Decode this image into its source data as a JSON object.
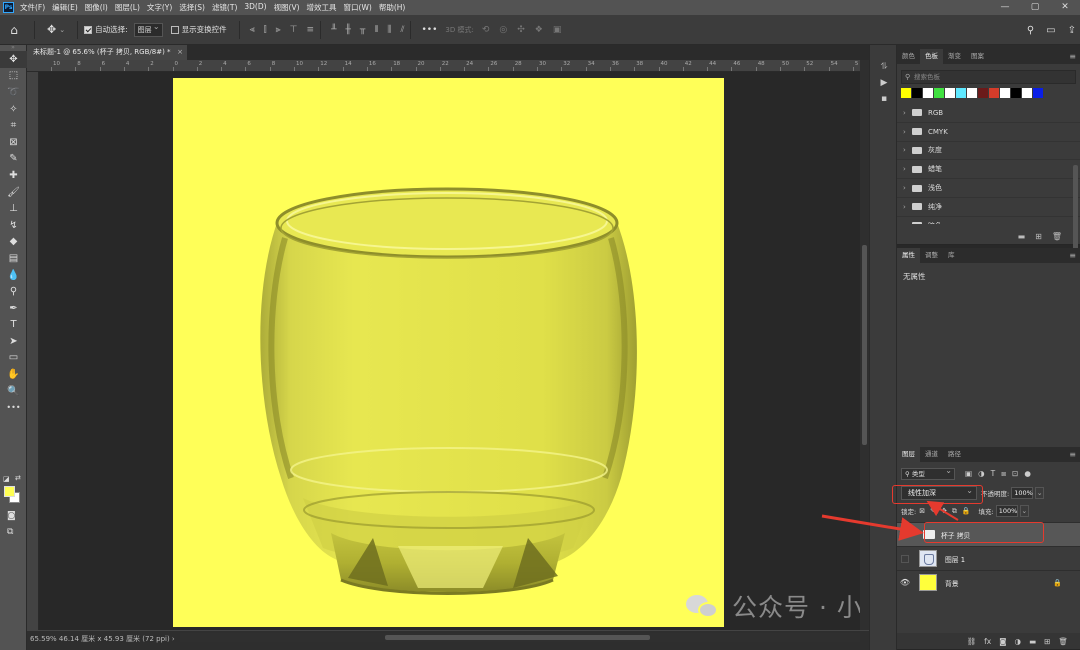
{
  "app": {
    "logo": "Ps"
  },
  "menu": [
    "文件(F)",
    "编辑(E)",
    "图像(I)",
    "图层(L)",
    "文字(Y)",
    "选择(S)",
    "滤镜(T)",
    "3D(D)",
    "视图(V)",
    "增效工具",
    "窗口(W)",
    "帮助(H)"
  ],
  "window_controls": {
    "minimize": "—",
    "restore": "▢",
    "close": "✕"
  },
  "options": {
    "home_icon": "⌂",
    "move_icon": "✥",
    "auto_select_label": "自动选择:",
    "auto_select_value": "图层",
    "show_transform_label": "显示变换控件",
    "more": "•••",
    "mode_3d_label": "3D 模式:"
  },
  "document": {
    "tab_title": "未标题-1 @ 65.6% (杯子 拷贝, RGB/8#) *",
    "tab_close": "×",
    "status": "65.59%  46.14 厘米 x 45.93 厘米 (72 ppi)  ›"
  },
  "rulers": {
    "top": [
      "10",
      "8",
      "6",
      "4",
      "2",
      "0",
      "2",
      "4",
      "6",
      "8",
      "10",
      "12",
      "14",
      "16",
      "18",
      "20",
      "22",
      "24",
      "26",
      "28",
      "30",
      "32",
      "34",
      "36",
      "38",
      "40",
      "42",
      "44",
      "46",
      "48",
      "50",
      "52",
      "54",
      "5"
    ]
  },
  "swatches_panel": {
    "tabs": [
      "颜色",
      "色板",
      "渐变",
      "图案"
    ],
    "active_tab": 1,
    "search_placeholder": "搜索色板",
    "colors": [
      "#ffff00",
      "#000000",
      "#ffffff",
      "#40e040",
      "#ffffff",
      "#5fe8ff",
      "#ffffff",
      "#6b1a1a",
      "#d43c2a",
      "#ffffff",
      "#000000",
      "#ffffff",
      "#0a1ee6"
    ],
    "folders": [
      "RGB",
      "CMYK",
      "灰度",
      "蜡笔",
      "浅色",
      "纯净",
      "暗色"
    ]
  },
  "properties_panel": {
    "tabs": [
      "属性",
      "调整",
      "库"
    ],
    "active_tab": 0,
    "empty_text": "无属性"
  },
  "layers_panel": {
    "tabs": [
      "图层",
      "通道",
      "路径"
    ],
    "active_tab": 0,
    "filter_kind": "类型",
    "blend_mode": "线性加深",
    "opacity_label": "不透明度:",
    "opacity_value": "100%",
    "lock_label": "锁定:",
    "fill_label": "填充:",
    "fill_value": "100%",
    "layers": [
      {
        "name": "杯子 拷贝",
        "type": "group",
        "visible": true,
        "selected": true
      },
      {
        "name": "图层 1",
        "type": "image",
        "visible": false,
        "selected": false
      },
      {
        "name": "背景",
        "type": "fill",
        "visible": true,
        "selected": false,
        "locked": true
      }
    ]
  },
  "watermark": {
    "text": "公众号 · 小白电脑技术"
  },
  "colors": {
    "canvas_yellow": "#ffff58",
    "annotation_red": "#e53a2e"
  }
}
